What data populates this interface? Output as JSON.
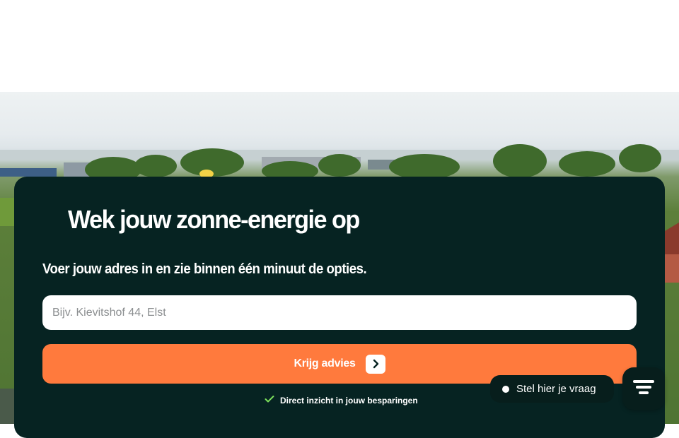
{
  "hero": {
    "headline": "Wek jouw zonne-energie op",
    "subline": "Voer jouw adres in en zie binnen één minuut de opties."
  },
  "address_form": {
    "placeholder": "Bijv. Kievitshof 44, Elst",
    "value": "",
    "submit_label": "Krijg advies",
    "benefit": "Direct inzicht in jouw besparingen"
  },
  "chat": {
    "label": "Stel hier je vraag"
  },
  "icons": {
    "submit_arrow": "chevron-right-icon",
    "benefit_check": "check-icon",
    "chat_status": "dot-icon",
    "menu": "menu-icon"
  },
  "colors": {
    "card_background": "#062322",
    "accent": "#ff7a3d",
    "check": "#7ee35c"
  }
}
